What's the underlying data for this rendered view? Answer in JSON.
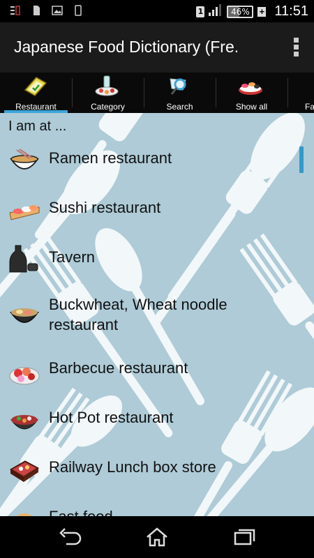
{
  "status_bar": {
    "time": "11:51",
    "battery_percent": "46%",
    "battery_level": 0.46,
    "sim_label": "1",
    "icons": [
      "notification-icon",
      "sd-card-icon",
      "image-icon",
      "phone-icon",
      "signal-icon",
      "battery-icon"
    ]
  },
  "app_bar": {
    "title": "Japanese Food Dictionary (Fre.",
    "overflow_icon": "overflow-menu-icon"
  },
  "tabs": [
    {
      "label": "Restaurant",
      "icon": "restaurant-book-icon",
      "active": true
    },
    {
      "label": "Category",
      "icon": "category-dishes-icon",
      "active": false
    },
    {
      "label": "Search",
      "icon": "search-magnifier-icon",
      "active": false
    },
    {
      "label": "Show all",
      "icon": "sushi-plate-icon",
      "active": false
    },
    {
      "label": "Fa",
      "icon": "favorites-icon",
      "active": false
    }
  ],
  "content": {
    "header": "I am at ...",
    "items": [
      {
        "label": "Ramen restaurant",
        "icon": "ramen-bowl-icon"
      },
      {
        "label": "Sushi restaurant",
        "icon": "sushi-icon"
      },
      {
        "label": "Tavern",
        "icon": "sake-bottle-icon"
      },
      {
        "label": "Buckwheat, Wheat noodle restaurant",
        "icon": "noodle-bowl-icon"
      },
      {
        "label": "Barbecue restaurant",
        "icon": "barbecue-plate-icon"
      },
      {
        "label": "Hot Pot restaurant",
        "icon": "hot-pot-icon"
      },
      {
        "label": "Railway Lunch box store",
        "icon": "bento-box-icon"
      },
      {
        "label": "Fast food",
        "icon": "fast-food-icon"
      }
    ]
  },
  "nav_bar": {
    "buttons": [
      "back-icon",
      "home-icon",
      "recent-apps-icon"
    ]
  },
  "colors": {
    "content_background": "#aecbd7",
    "active_tab_indicator": "#3ba5d8",
    "scrollbar": "#3399cc"
  }
}
